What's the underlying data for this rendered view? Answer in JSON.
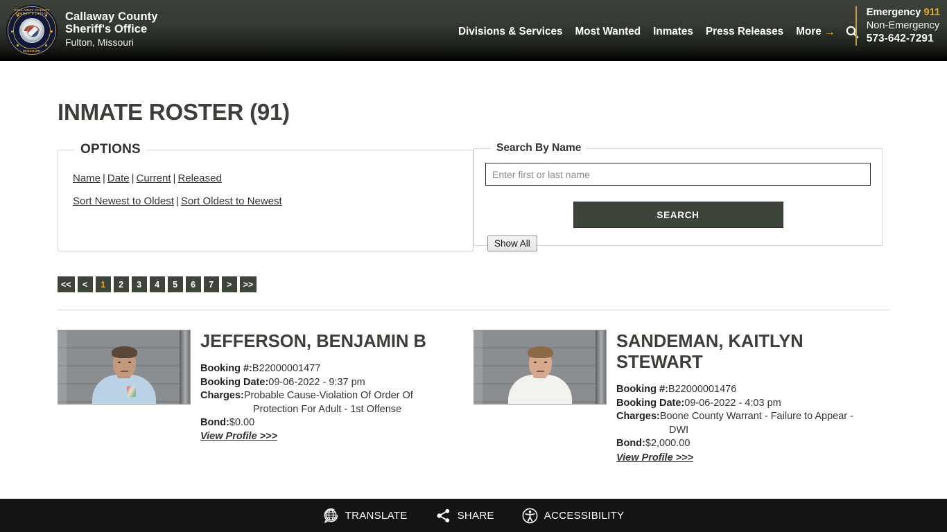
{
  "header": {
    "logo_name": "callaway-county-sheriff-badge",
    "logo_ring_top": "CALLAWAY COUNTY SHERIFF'S OFFICE",
    "logo_ring_bottom": "MISSOURI",
    "brand_line1": "Callaway County",
    "brand_line2": "Sheriff's Office",
    "brand_line3": "Fulton, Missouri",
    "nav": [
      {
        "label": "Divisions & Services"
      },
      {
        "label": "Most Wanted"
      },
      {
        "label": "Inmates"
      },
      {
        "label": "Press Releases"
      },
      {
        "label": "More"
      }
    ],
    "more_arrow": "→",
    "search_icon": "search-icon",
    "contact": {
      "emergency_label": "Emergency",
      "emergency_number": "911",
      "non_emergency_label": "Non-Emergency",
      "non_emergency_number": "573-642-7291"
    },
    "accent_gold": "#e0a82e",
    "background": "#3c423a"
  },
  "main": {
    "page_title": "INMATE ROSTER (91)",
    "options_panel": {
      "legend": "OPTIONS",
      "filter_links": [
        "Name",
        "Date",
        "Current",
        "Released"
      ],
      "sort_links": [
        "Sort Newest to Oldest",
        "Sort Oldest to Newest"
      ],
      "separator": "|"
    },
    "search_panel": {
      "legend": "Search By Name",
      "input_value": "",
      "input_placeholder": "Enter first or last name",
      "submit_label": "SEARCH",
      "show_all_label": "Show All"
    },
    "pagination": {
      "items": [
        "<<",
        "<",
        "1",
        "2",
        "3",
        "4",
        "5",
        "6",
        "7",
        ">",
        ">>"
      ],
      "active": "1"
    },
    "labels": {
      "booking_number": "Booking #:",
      "booking_date": "Booking Date:",
      "charges": "Charges:",
      "bond": "Bond:",
      "view_profile": "View Profile >>>"
    },
    "inmates": [
      {
        "name": "JEFFERSON, BENJAMIN B",
        "booking_number": "B22000001477",
        "booking_date": "09-06-2022 - 9:37 pm",
        "charges_line1": "Probable Cause-Violation Of Order Of",
        "charges_line2": "Protection For Adult - 1st Offense",
        "bond": "$0.00",
        "mugshot_alt": "mugshot of male inmate in light blue t-shirt"
      },
      {
        "name": "SANDEMAN, KAITLYN STEWART",
        "booking_number": "B22000001476",
        "booking_date": "09-06-2022 - 4:03 pm",
        "charges_line1": "Boone County Warrant - Failure to Appear -",
        "charges_line2": "DWI",
        "bond": "$2,000.00",
        "mugshot_alt": "mugshot of female inmate in white top"
      }
    ]
  },
  "bottom_bar": {
    "items": [
      {
        "label": "TRANSLATE",
        "icon": "translate-globe-icon"
      },
      {
        "label": "SHARE",
        "icon": "share-icon"
      },
      {
        "label": "ACCESSIBILITY",
        "icon": "accessibility-icon"
      }
    ]
  }
}
